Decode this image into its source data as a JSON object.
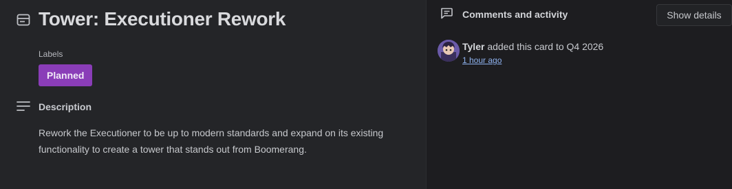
{
  "card": {
    "title": "Tower: Executioner Rework",
    "labels_heading": "Labels",
    "labels": [
      {
        "text": "Planned",
        "color": "#8a3db8"
      }
    ],
    "description_heading": "Description",
    "description": "Rework the Executioner to be up to modern standards and expand on its existing functionality to create a tower that stands out from Boomerang."
  },
  "activity": {
    "heading": "Comments and activity",
    "show_details_label": "Show details",
    "entries": [
      {
        "user": "Tyler",
        "action": " added this card to Q4 2026",
        "time": "1 hour ago"
      }
    ]
  },
  "icons": {
    "card": "card-icon",
    "description": "description-lines-icon",
    "activity": "comment-icon"
  },
  "colors": {
    "main_bg": "#242528",
    "side_bg": "#1d1d20",
    "label_purple": "#8a3db8",
    "link_blue": "#8fb3f0"
  }
}
